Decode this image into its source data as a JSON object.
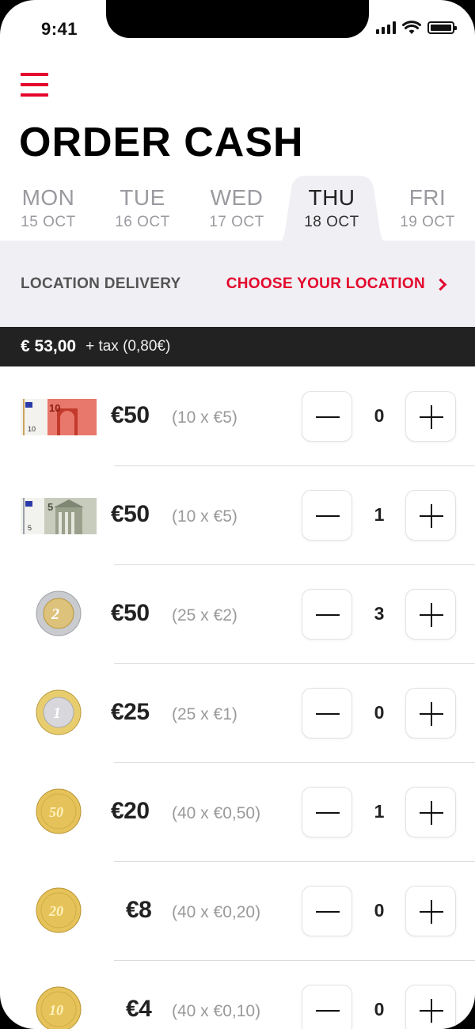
{
  "status_bar": {
    "time": "9:41"
  },
  "header": {
    "title": "ORDER CASH"
  },
  "tabs": [
    {
      "day": "MON",
      "date": "15 OCT"
    },
    {
      "day": "TUE",
      "date": "16 OCT"
    },
    {
      "day": "WED",
      "date": "17 OCT"
    },
    {
      "day": "THU",
      "date": "18 OCT"
    },
    {
      "day": "FRI",
      "date": "19 OCT"
    }
  ],
  "active_tab": "THU",
  "location": {
    "label": "LOCATION DELIVERY",
    "action": "CHOOSE YOUR LOCATION"
  },
  "total": {
    "amount": "€ 53,00",
    "tax": "+ tax (0,80€)"
  },
  "items": [
    {
      "icon": "banknote-10-icon",
      "amount": "€50",
      "detail": "(10 x €5)",
      "quantity": "0"
    },
    {
      "icon": "banknote-5-icon",
      "amount": "€50",
      "detail": "(10 x €5)",
      "quantity": "1"
    },
    {
      "icon": "coin-2-euro-icon",
      "amount": "€50",
      "detail": "(25 x €2)",
      "quantity": "3"
    },
    {
      "icon": "coin-1-euro-icon",
      "amount": "€25",
      "detail": "(25 x €1)",
      "quantity": "0"
    },
    {
      "icon": "coin-50-cent-icon",
      "amount": "€20",
      "detail": "(40 x €0,50)",
      "quantity": "1"
    },
    {
      "icon": "coin-20-cent-icon",
      "amount": "€8",
      "detail": "(40 x €0,20)",
      "quantity": "0"
    },
    {
      "icon": "coin-10-cent-icon",
      "amount": "€4",
      "detail": "(40 x €0,10)",
      "quantity": "0"
    }
  ],
  "icon_labels": {
    "banknote_10": "10",
    "banknote_5": "5",
    "coin_2": "2",
    "coin_1": "1",
    "coin_50": "50",
    "coin_20": "20",
    "coin_10": "10"
  },
  "colors": {
    "accent": "#e4062c",
    "band": "#efeff4",
    "total_bar": "#222222"
  }
}
